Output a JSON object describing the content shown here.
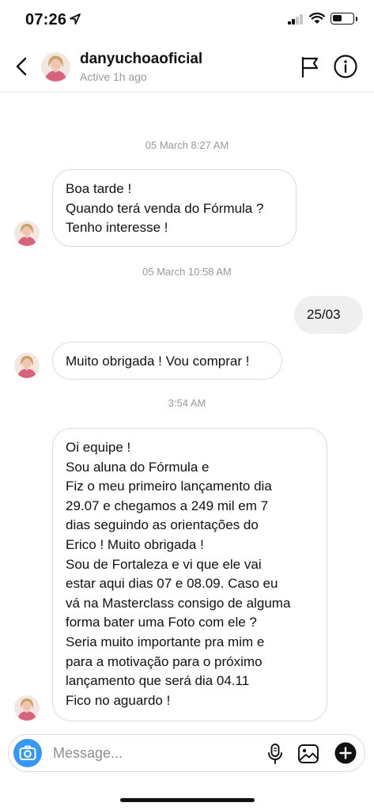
{
  "status_bar": {
    "time": "07:26",
    "location_icon": "location-arrow-icon",
    "signal_bars": 2,
    "battery_level": 0.5
  },
  "header": {
    "username": "danyuchoaoficial",
    "status": "Active 1h ago",
    "back_icon": "chevron-left-icon",
    "flag_icon": "flag-icon",
    "info_icon": "info-icon"
  },
  "messages": [
    {
      "type": "timestamp",
      "text": "05 March 8:27 AM"
    },
    {
      "type": "incoming",
      "lines": [
        "Boa tarde !",
        "Quando terá venda do Fórmula ?",
        "Tenho interesse !"
      ]
    },
    {
      "type": "timestamp",
      "text": "05 March 10:58 AM"
    },
    {
      "type": "outgoing",
      "lines": [
        "25/03"
      ]
    },
    {
      "type": "incoming",
      "lines": [
        "Muito obrigada ! Vou comprar !"
      ]
    },
    {
      "type": "timestamp",
      "text": "3:54 AM"
    },
    {
      "type": "incoming",
      "lines": [
        "Oi equipe !",
        "Sou aluna do Fórmula e",
        "Fiz o meu primeiro lançamento dia",
        "29.07 e chegamos a 249 mil em 7",
        "dias seguindo as orientações do",
        "Erico ! Muito obrigada !",
        "Sou de Fortaleza e vi que ele vai",
        "estar aqui dias 07 e 08.09. Caso eu",
        "vá na Masterclass consigo de alguma",
        "forma bater uma Foto com ele ?",
        "Seria muito importante pra mim e",
        "para a motivação para o próximo",
        "lançamento que será dia 04.11",
        "Fico no aguardo !"
      ]
    }
  ],
  "composer": {
    "placeholder": "Message...",
    "camera_icon": "camera-icon",
    "mic_icon": "microphone-icon",
    "gallery_icon": "image-gallery-icon",
    "plus_icon": "plus-circle-icon"
  },
  "colors": {
    "camera_button": "#3897f0",
    "outgoing_bubble": "#efefef",
    "bubble_border": "#dbdbdb",
    "secondary_text": "#999999",
    "avatar_pink": "#d8627c"
  }
}
